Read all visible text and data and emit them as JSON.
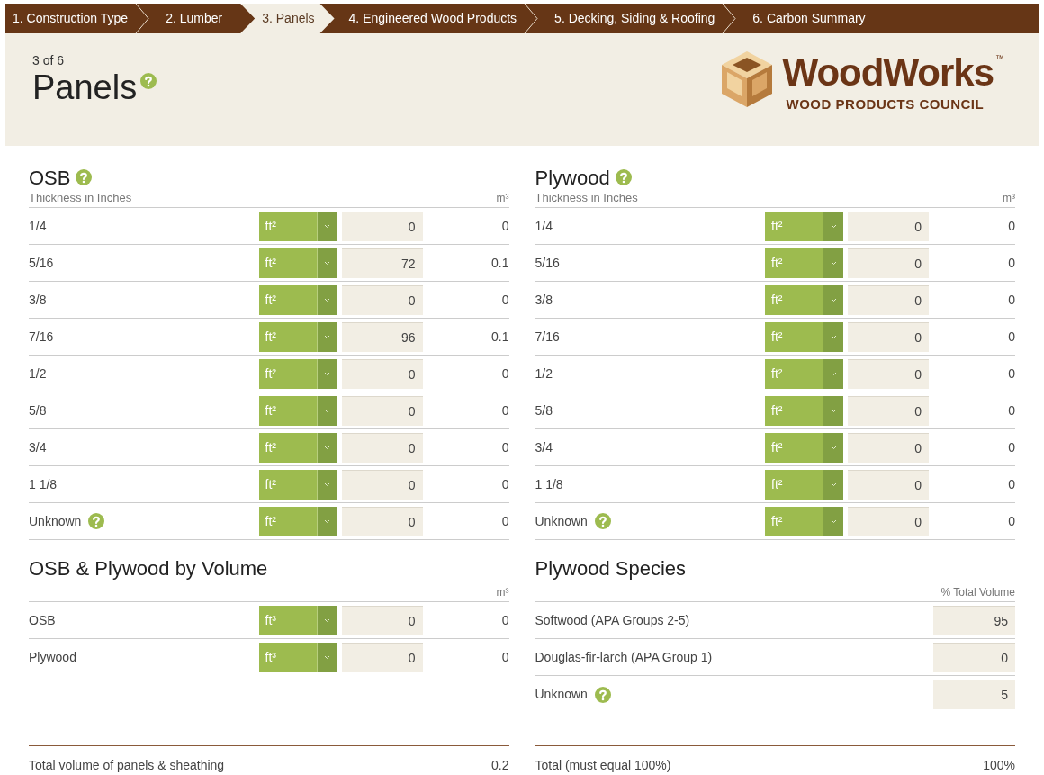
{
  "tabs": [
    {
      "label": "1. Construction Type",
      "selected": false
    },
    {
      "label": "2. Lumber",
      "selected": false
    },
    {
      "label": "3. Panels",
      "selected": true
    },
    {
      "label": "4. Engineered Wood Products",
      "selected": false
    },
    {
      "label": "5. Decking, Siding & Roofing",
      "selected": false
    },
    {
      "label": "6. Carbon Summary",
      "selected": false
    }
  ],
  "header": {
    "step": "3 of 6",
    "title": "Panels",
    "help": true
  },
  "logo": {
    "name": "WoodWorks",
    "trademark": "™",
    "subtitle": "WOOD PRODUCTS COUNCIL"
  },
  "osb": {
    "title": "OSB",
    "help": true,
    "column_label": "Thickness in Inches",
    "unit_header": "m³",
    "rows": [
      {
        "label": "1/4",
        "unit": "ft²",
        "value": "0",
        "volume": "0",
        "help": false
      },
      {
        "label": "5/16",
        "unit": "ft²",
        "value": "72",
        "volume": "0.1",
        "help": false
      },
      {
        "label": "3/8",
        "unit": "ft²",
        "value": "0",
        "volume": "0",
        "help": false
      },
      {
        "label": "7/16",
        "unit": "ft²",
        "value": "96",
        "volume": "0.1",
        "help": false
      },
      {
        "label": "1/2",
        "unit": "ft²",
        "value": "0",
        "volume": "0",
        "help": false
      },
      {
        "label": "5/8",
        "unit": "ft²",
        "value": "0",
        "volume": "0",
        "help": false
      },
      {
        "label": "3/4",
        "unit": "ft²",
        "value": "0",
        "volume": "0",
        "help": false
      },
      {
        "label": "1 1/8",
        "unit": "ft²",
        "value": "0",
        "volume": "0",
        "help": false
      },
      {
        "label": "Unknown",
        "unit": "ft²",
        "value": "0",
        "volume": "0",
        "help": true
      }
    ]
  },
  "plywood": {
    "title": "Plywood",
    "help": true,
    "column_label": "Thickness in Inches",
    "unit_header": "m³",
    "rows": [
      {
        "label": "1/4",
        "unit": "ft²",
        "value": "0",
        "volume": "0",
        "help": false
      },
      {
        "label": "5/16",
        "unit": "ft²",
        "value": "0",
        "volume": "0",
        "help": false
      },
      {
        "label": "3/8",
        "unit": "ft²",
        "value": "0",
        "volume": "0",
        "help": false
      },
      {
        "label": "7/16",
        "unit": "ft²",
        "value": "0",
        "volume": "0",
        "help": false
      },
      {
        "label": "1/2",
        "unit": "ft²",
        "value": "0",
        "volume": "0",
        "help": false
      },
      {
        "label": "5/8",
        "unit": "ft²",
        "value": "0",
        "volume": "0",
        "help": false
      },
      {
        "label": "3/4",
        "unit": "ft²",
        "value": "0",
        "volume": "0",
        "help": false
      },
      {
        "label": "1 1/8",
        "unit": "ft²",
        "value": "0",
        "volume": "0",
        "help": false
      },
      {
        "label": "Unknown",
        "unit": "ft²",
        "value": "0",
        "volume": "0",
        "help": true
      }
    ]
  },
  "by_volume": {
    "title": "OSB & Plywood by Volume",
    "unit_header": "m³",
    "rows": [
      {
        "label": "OSB",
        "unit": "ft³",
        "value": "0",
        "volume": "0"
      },
      {
        "label": "Plywood",
        "unit": "ft³",
        "value": "0",
        "volume": "0"
      }
    ]
  },
  "species": {
    "title": "Plywood Species",
    "column_header": "% Total Volume",
    "rows": [
      {
        "label": "Softwood (APA Groups 2-5)",
        "value": "95",
        "help": false
      },
      {
        "label": "Douglas-fir-larch (APA Group 1)",
        "value": "0",
        "help": false
      },
      {
        "label": "Unknown",
        "value": "5",
        "help": true
      }
    ]
  },
  "totals": [
    {
      "label": "Total volume of panels & sheathing",
      "value": "0.2"
    },
    {
      "label": "Total (must equal 100%)",
      "value": "100%"
    }
  ]
}
